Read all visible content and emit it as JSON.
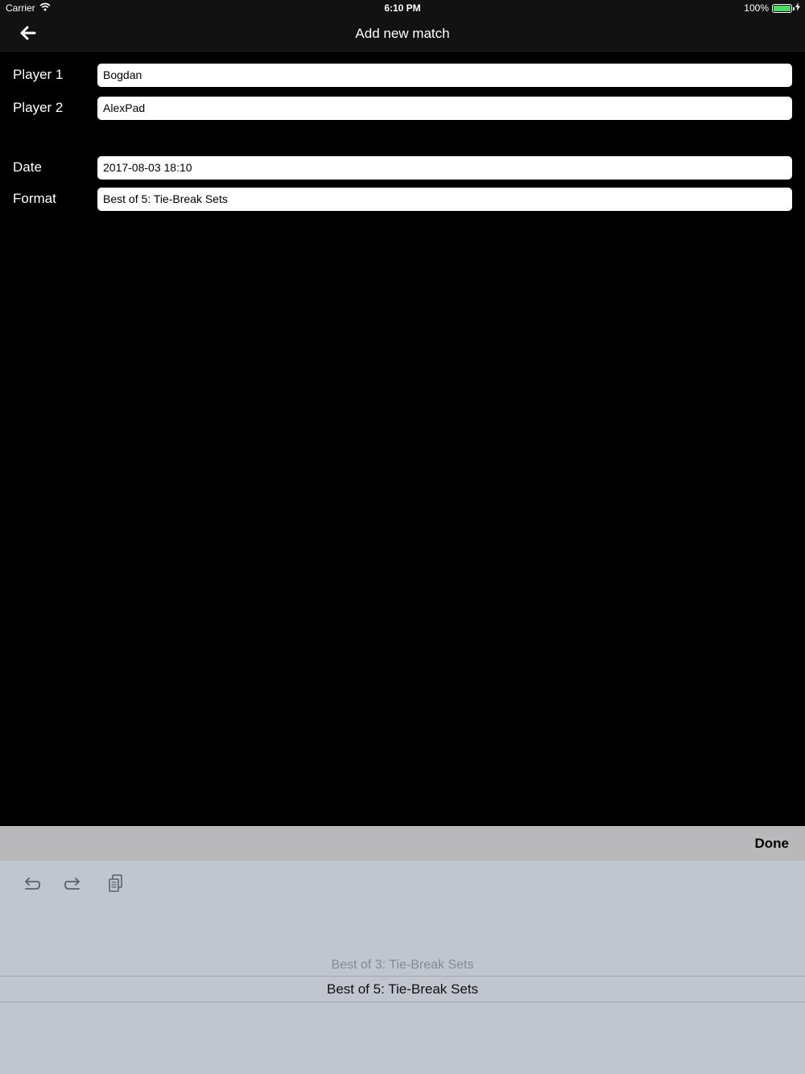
{
  "status_bar": {
    "carrier": "Carrier",
    "time": "6:10 PM",
    "battery": "100%",
    "battery_level": 1.0,
    "battery_color": "#4cd964"
  },
  "nav": {
    "back_icon": "arrow-left-icon",
    "title": "Add new match"
  },
  "form": {
    "player1": {
      "label": "Player 1",
      "value": "Bogdan"
    },
    "player2": {
      "label": "Player 2",
      "value": "AlexPad"
    },
    "date": {
      "label": "Date",
      "value": "2017-08-03 18:10"
    },
    "format": {
      "label": "Format",
      "value": "Best of 5: Tie-Break Sets"
    }
  },
  "keyboard": {
    "done_label": "Done",
    "shortcuts": [
      "undo-icon",
      "redo-icon",
      "paste-icon"
    ],
    "picker_options": [
      "Best of 3: Tie-Break Sets",
      "Best of 5: Tie-Break Sets"
    ],
    "picker_selected": "Best of 5: Tie-Break Sets"
  },
  "colors": {
    "background": "#000000",
    "bar": "#121212",
    "accessory": "#b9b9bb",
    "panel": "#c1c5cd"
  }
}
